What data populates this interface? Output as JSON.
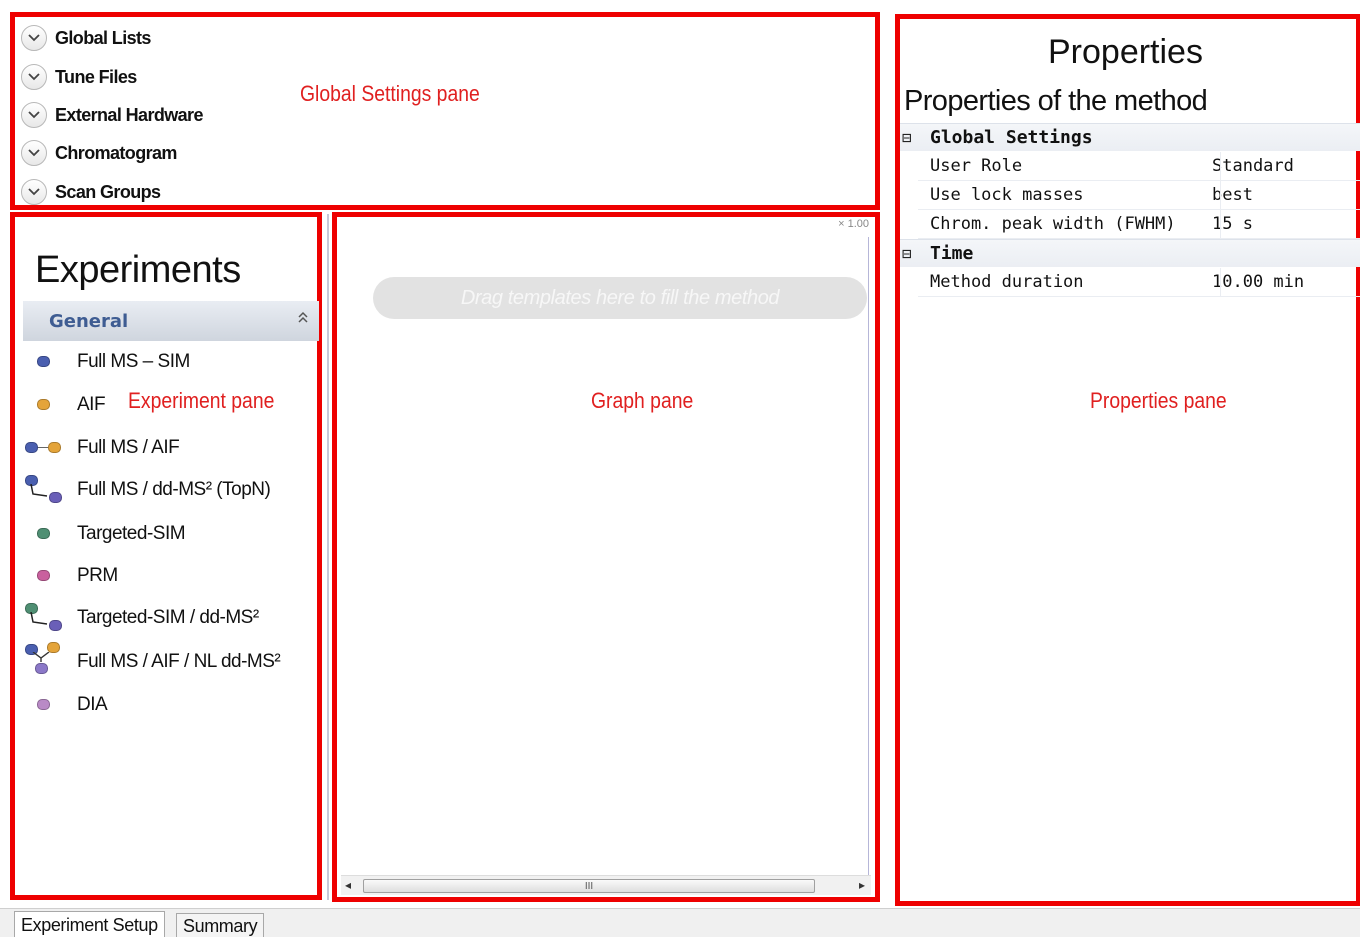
{
  "global_settings": {
    "items": [
      {
        "label": "Global Lists",
        "icon": "chevron-down-icon"
      },
      {
        "label": "Tune Files",
        "icon": "chevron-down-icon"
      },
      {
        "label": "External Hardware",
        "icon": "chevron-down-icon"
      },
      {
        "label": "Chromatogram",
        "icon": "chevron-down-icon"
      },
      {
        "label": "Scan Groups",
        "icon": "chevron-down-icon"
      }
    ]
  },
  "experiments": {
    "title": "Experiments",
    "group": "General",
    "items": [
      {
        "label": "Full MS – SIM",
        "icon": "full-ms-sim-icon",
        "colors": [
          "#4a5fb0"
        ]
      },
      {
        "label": "AIF",
        "icon": "aif-icon",
        "colors": [
          "#e4a43a"
        ]
      },
      {
        "label": "Full MS / AIF",
        "icon": "full-ms-aif-icon",
        "colors": [
          "#4a5fb0",
          "#e4a43a"
        ]
      },
      {
        "label": "Full MS / dd-MS² (TopN)",
        "icon": "full-ms-dd-ms2-icon",
        "colors": [
          "#4a5fb0",
          "#6a5fb8"
        ]
      },
      {
        "label": "Targeted-SIM",
        "icon": "targeted-sim-icon",
        "colors": [
          "#4f8f73"
        ]
      },
      {
        "label": "PRM",
        "icon": "prm-icon",
        "colors": [
          "#c9609e"
        ]
      },
      {
        "label": "Targeted-SIM / dd-MS²",
        "icon": "targeted-sim-dd-ms2-icon",
        "colors": [
          "#4f8f73",
          "#6a5fb8"
        ]
      },
      {
        "label": "Full MS / AIF / NL dd-MS²",
        "icon": "full-ms-aif-nl-dd-ms2-icon",
        "colors": [
          "#4a5fb0",
          "#e4a43a",
          "#8b78c8"
        ]
      },
      {
        "label": "DIA",
        "icon": "dia-icon",
        "colors": [
          "#b98ac6"
        ]
      }
    ]
  },
  "graph": {
    "zoom": "× 1.00",
    "placeholder": "Drag templates here to fill the method",
    "scroll_thumb": "III"
  },
  "properties": {
    "title": "Properties",
    "subtitle": "Properties of the method",
    "groups": [
      {
        "toggle": "⊟",
        "label": "Global Settings",
        "rows": [
          {
            "name": "User Role",
            "value": "Standard"
          },
          {
            "name": "Use lock masses",
            "value": "best"
          },
          {
            "name": "Chrom. peak width (FWHM)",
            "value": "15 s"
          }
        ]
      },
      {
        "toggle": "⊟",
        "label": "Time",
        "rows": [
          {
            "name": "Method duration",
            "value": "10.00 min"
          }
        ]
      }
    ]
  },
  "annotations": {
    "global_settings_pane": "Global Settings pane",
    "experiment_pane": "Experiment pane",
    "graph_pane": "Graph pane",
    "properties_pane": "Properties pane",
    "highlight_color": "#ee0000"
  },
  "tabs": [
    {
      "label": "Experiment Setup",
      "active": true
    },
    {
      "label": "Summary",
      "active": false
    }
  ]
}
